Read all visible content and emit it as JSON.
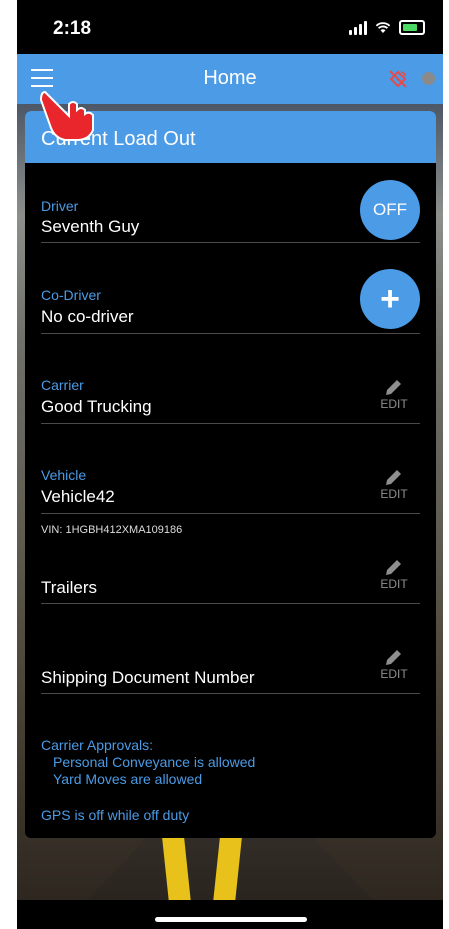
{
  "status_bar": {
    "time": "2:18"
  },
  "app_bar": {
    "title": "Home",
    "icons": [
      "menu-icon",
      "satellite-off-icon",
      "status-dot"
    ]
  },
  "card": {
    "title": "Current Load Out",
    "driver": {
      "label": "Driver",
      "value": "Seventh Guy",
      "button": "OFF"
    },
    "co_driver": {
      "label": "Co-Driver",
      "value": "No co-driver",
      "button": "+"
    },
    "carrier": {
      "label": "Carrier",
      "value": "Good Trucking",
      "edit": "EDIT"
    },
    "vehicle": {
      "label": "Vehicle",
      "value": "Vehicle42",
      "edit": "EDIT",
      "vin": "VIN: 1HGBH412XMA109186"
    },
    "trailers": {
      "value": "Trailers",
      "edit": "EDIT"
    },
    "shipping": {
      "value": "Shipping Document Number",
      "edit": "EDIT"
    },
    "approvals": {
      "title": "Carrier Approvals:",
      "items": [
        "Personal Conveyance is allowed",
        "Yard Moves are allowed"
      ]
    },
    "gps_note": "GPS is off while off duty"
  },
  "colors": {
    "accent": "#4b9be6",
    "card_bg": "#000000",
    "divider": "#4a4a4a",
    "edit_gray": "#8e8e8e",
    "sat_red": "#e64b4b"
  }
}
